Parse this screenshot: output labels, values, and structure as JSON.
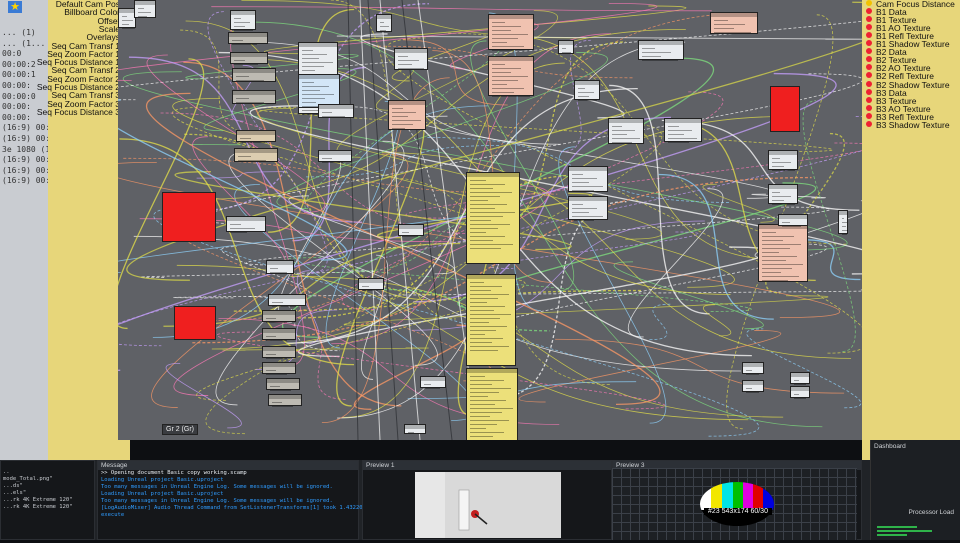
{
  "left_list": [
    "... (1)",
    "... (1...",
    "00:0",
    "00:00:2",
    "00:00:1",
    "00:00:",
    "00:00:0",
    "00:00:",
    "00:00:",
    "(16:9)  00:...",
    "(16:9)  00:...",
    "3e 1080 (16:...",
    "(16:9)  00:...",
    "(16:9)  00:...",
    "(16:9)  00:..."
  ],
  "left_inputs": [
    {
      "label": "Default Cam Pos",
      "dot": "green"
    },
    {
      "label": "Billboard Color",
      "dot": "green"
    },
    {
      "label": "Offset",
      "dot": "green"
    },
    {
      "label": "Scale",
      "dot": "green"
    },
    {
      "label": "Overlays",
      "dot": "green"
    },
    {
      "label": "Seq Cam Transf 1",
      "dot": "green"
    },
    {
      "label": "Seq Zoom Factor 1",
      "dot": "green"
    },
    {
      "label": "Seq Focus Distance 1",
      "dot": "dark"
    },
    {
      "label": "Seq Cam Transf 2",
      "dot": "green"
    },
    {
      "label": "Seq Zoom Factor 2",
      "dot": "green"
    },
    {
      "label": "Seq Focus Distance 2",
      "dot": "dark"
    },
    {
      "label": "Seq Cam Transf 3",
      "dot": "green"
    },
    {
      "label": "Seq Zoom Factor 3",
      "dot": "green"
    },
    {
      "label": "Seq Focus Distance 3",
      "dot": "dark"
    }
  ],
  "right_outputs": [
    {
      "label": "Cam Focus Distance",
      "dot": "yellow"
    },
    {
      "label": "B1 Data",
      "dot": "red"
    },
    {
      "label": "B1 Texture",
      "dot": "red"
    },
    {
      "label": "B1 AO Texture",
      "dot": "red"
    },
    {
      "label": "B1 Refl Texture",
      "dot": "red"
    },
    {
      "label": "B1 Shadow Texture",
      "dot": "red"
    },
    {
      "label": "B2 Data",
      "dot": "red"
    },
    {
      "label": "B2 Texture",
      "dot": "red"
    },
    {
      "label": "B2 AO Texture",
      "dot": "red"
    },
    {
      "label": "B2 Refl Texture",
      "dot": "red"
    },
    {
      "label": "B2 Shadow Texture",
      "dot": "red"
    },
    {
      "label": "B3 Data",
      "dot": "red"
    },
    {
      "label": "B3 Texture",
      "dot": "red"
    },
    {
      "label": "B3 AO Texture",
      "dot": "red"
    },
    {
      "label": "B3 Refl Texture",
      "dot": "red"
    },
    {
      "label": "B3 Shadow Texture",
      "dot": "red"
    }
  ],
  "canvas": {
    "zoom_label": "Gr 2 (Gr)"
  },
  "panels": {
    "message": {
      "title": "Message",
      "lines": [
        {
          "text": ">> Opening document Basic copy working.scamp",
          "style": "white"
        },
        {
          "text": "Loading Unreal project Basic.uproject",
          "style": "blue"
        },
        {
          "text": "Too many messages in Unreal Engine Log. Some messages will be ignored.",
          "style": "blue"
        },
        {
          "text": "Loading Unreal project Basic.uproject",
          "style": "blue"
        },
        {
          "text": "Too many messages in Unreal Engine Log. Some messages will be ignored.",
          "style": "blue"
        },
        {
          "text": "[LogAudioMixer] Audio Thread Command from SetListenerTransforms[1] took 1.432200 milliseconds to",
          "style": "blue"
        },
        {
          "text": "execute",
          "style": "blue"
        }
      ]
    },
    "left_log": {
      "lines": [
        "..",
        "mode_Total.png\"",
        "...ds\"",
        "...els\"",
        "...rk 4K Extreme 120\"",
        "...rk 4K Extreme 120\""
      ]
    },
    "preview1": {
      "title": "Preview 1"
    },
    "preview3": {
      "title": "Preview 3",
      "testcard_label": "#23 543x174 60/30"
    },
    "dashboard": {
      "title": "Dashboard",
      "sub": "Processor Load"
    }
  },
  "colors": {
    "panel_yellow": "#e7d67a",
    "canvas_gray": "#5f6166",
    "node_red": "#ef1f1f",
    "node_yellow": "#ece07a",
    "node_salmon": "#f0c2b0"
  }
}
